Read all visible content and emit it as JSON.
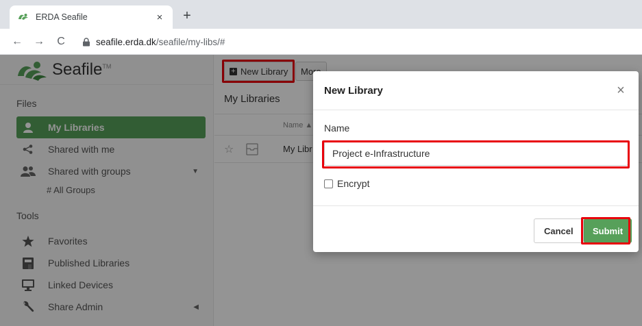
{
  "browser": {
    "tab_title": "ERDA Seafile",
    "tab_close": "×",
    "new_tab": "+",
    "back": "←",
    "forward": "→",
    "reload": "C",
    "url_host": "seafile.erda.dk",
    "url_path": "/seafile/my-libs/#"
  },
  "app": {
    "logo_text": "Seafile",
    "logo_tm": "TM"
  },
  "sidebar": {
    "files_heading": "Files",
    "items": [
      {
        "label": "My Libraries",
        "icon": "user-icon",
        "active": true
      },
      {
        "label": "Shared with me",
        "icon": "share-icon"
      },
      {
        "label": "Shared with groups",
        "icon": "group-icon"
      }
    ],
    "all_groups": "# All Groups",
    "tools_heading": "Tools",
    "tools": [
      {
        "label": "Favorites",
        "icon": "star-icon"
      },
      {
        "label": "Published Libraries",
        "icon": "book-icon"
      },
      {
        "label": "Linked Devices",
        "icon": "monitor-icon"
      },
      {
        "label": "Share Admin",
        "icon": "wrench-icon"
      }
    ]
  },
  "main": {
    "new_library_label": "New Library",
    "more_label": "More",
    "title": "My Libraries",
    "col_name": "Name ▲",
    "row_name": "My Libr"
  },
  "modal": {
    "title": "New Library",
    "close": "×",
    "name_label": "Name",
    "name_value": "Project e-Infrastructure",
    "encrypt_label": "Encrypt",
    "cancel_label": "Cancel",
    "submit_label": "Submit"
  },
  "colors": {
    "accent_green": "#57a05a",
    "highlight_red": "#e8000b"
  }
}
